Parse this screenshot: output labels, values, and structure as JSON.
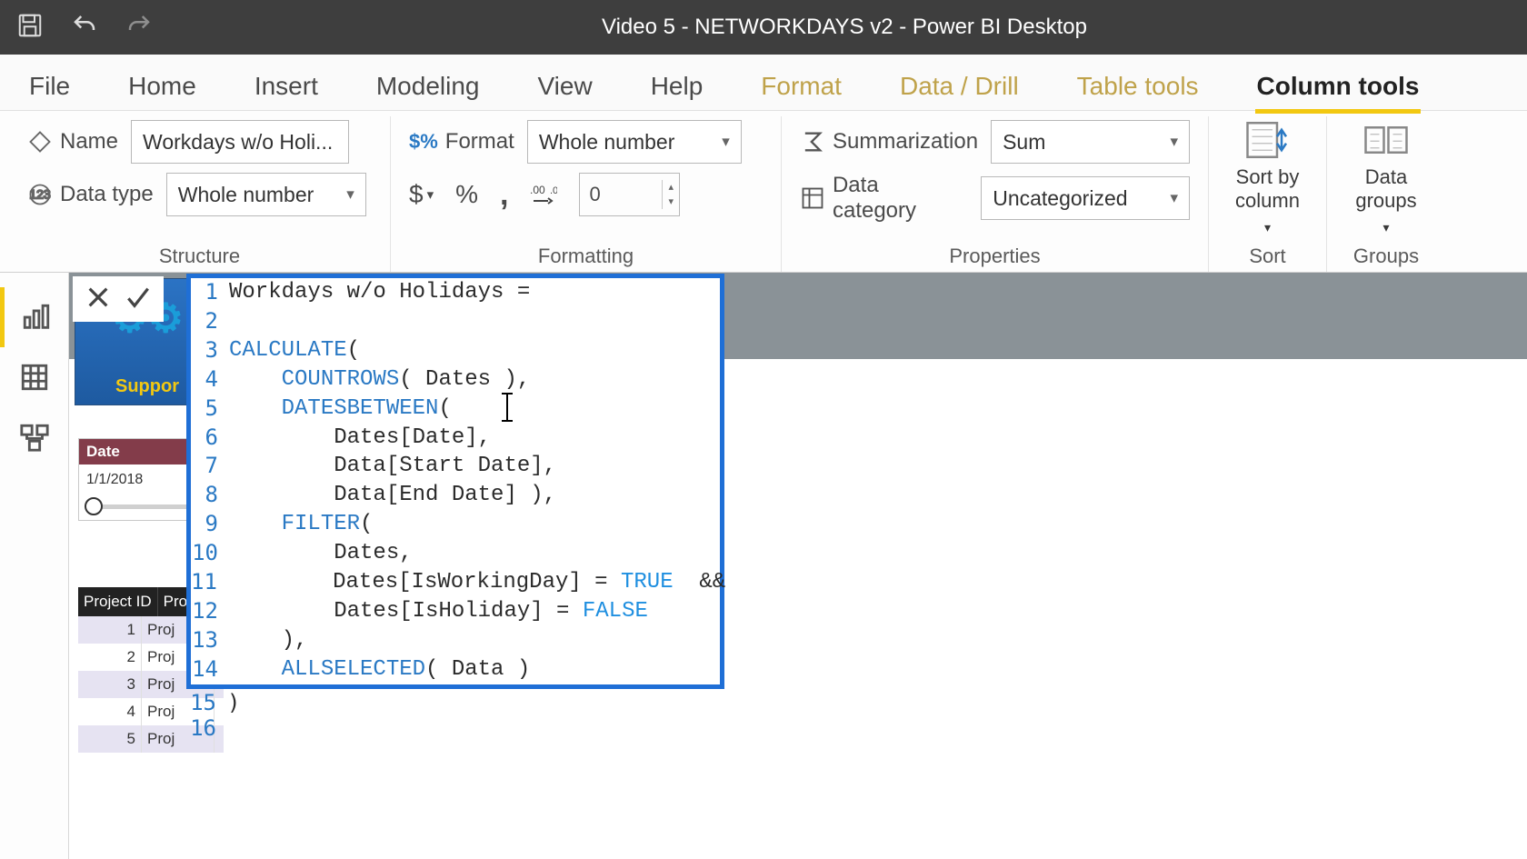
{
  "title": "Video 5 - NETWORKDAYS v2 - Power BI Desktop",
  "qat": {
    "save": "save-icon",
    "undo": "undo-icon",
    "redo": "redo-icon"
  },
  "tabs": [
    "File",
    "Home",
    "Insert",
    "Modeling",
    "View",
    "Help",
    "Format",
    "Data / Drill",
    "Table tools",
    "Column tools"
  ],
  "active_tab_index": 9,
  "contextual_start_index": 6,
  "ribbon": {
    "structure": {
      "label": "Structure",
      "name_label": "Name",
      "name_value": "Workdays w/o Holi...",
      "datatype_label": "Data type",
      "datatype_value": "Whole number"
    },
    "formatting": {
      "label": "Formatting",
      "format_label": "Format",
      "format_value": "Whole number",
      "currency": "$",
      "percent": "%",
      "thousand": ",",
      "decimals_icon": ".00→.0",
      "decimals_value": "0"
    },
    "properties": {
      "label": "Properties",
      "summarization_label": "Summarization",
      "summarization_value": "Sum",
      "category_label": "Data category",
      "category_value": "Uncategorized"
    },
    "sort": {
      "label": "Sort",
      "button": "Sort by\ncolumn"
    },
    "groups": {
      "label": "Groups",
      "button": "Data\ngroups"
    }
  },
  "leftnav": [
    "report-view",
    "data-view",
    "model-view"
  ],
  "slicer": {
    "header": "Date",
    "value": "1/1/2018"
  },
  "support_text": "Suppor",
  "table": {
    "headers": [
      "Project ID",
      "Proj"
    ],
    "rows": [
      [
        "1",
        "Proj"
      ],
      [
        "2",
        "Proj"
      ],
      [
        "3",
        "Proj"
      ],
      [
        "4",
        "Proj"
      ],
      [
        "5",
        "Proj"
      ]
    ]
  },
  "formula": {
    "cancel": "×",
    "commit": "✓",
    "lines": [
      {
        "n": "1",
        "tokens": [
          {
            "t": "txt",
            "v": "Workdays w/o Holidays = "
          }
        ]
      },
      {
        "n": "2",
        "tokens": [
          {
            "t": "txt",
            "v": ""
          }
        ]
      },
      {
        "n": "3",
        "tokens": [
          {
            "t": "fn",
            "v": "CALCULATE"
          },
          {
            "t": "txt",
            "v": "("
          }
        ]
      },
      {
        "n": "4",
        "tokens": [
          {
            "t": "txt",
            "v": "    "
          },
          {
            "t": "fn",
            "v": "COUNTROWS"
          },
          {
            "t": "txt",
            "v": "( Dates ),"
          }
        ]
      },
      {
        "n": "5",
        "tokens": [
          {
            "t": "txt",
            "v": "    "
          },
          {
            "t": "fn",
            "v": "DATESBETWEEN"
          },
          {
            "t": "txt",
            "v": "("
          },
          {
            "t": "cursor",
            "v": ""
          }
        ]
      },
      {
        "n": "6",
        "tokens": [
          {
            "t": "txt",
            "v": "        Dates[Date],"
          }
        ]
      },
      {
        "n": "7",
        "tokens": [
          {
            "t": "txt",
            "v": "        Data[Start Date],"
          }
        ]
      },
      {
        "n": "8",
        "tokens": [
          {
            "t": "txt",
            "v": "        Data[End Date] ),"
          }
        ]
      },
      {
        "n": "9",
        "tokens": [
          {
            "t": "txt",
            "v": "    "
          },
          {
            "t": "fn",
            "v": "FILTER"
          },
          {
            "t": "txt",
            "v": "("
          }
        ]
      },
      {
        "n": "10",
        "tokens": [
          {
            "t": "txt",
            "v": "        Dates,"
          }
        ]
      },
      {
        "n": "11",
        "tokens": [
          {
            "t": "txt",
            "v": "        Dates[IsWorkingDay] = "
          },
          {
            "t": "tf",
            "v": "TRUE"
          },
          {
            "t": "txt",
            "v": "  &&"
          }
        ]
      },
      {
        "n": "12",
        "tokens": [
          {
            "t": "txt",
            "v": "        Dates[IsHoliday] = "
          },
          {
            "t": "tf",
            "v": "FALSE"
          }
        ]
      },
      {
        "n": "13",
        "tokens": [
          {
            "t": "txt",
            "v": "    ),"
          }
        ]
      },
      {
        "n": "14",
        "tokens": [
          {
            "t": "txt",
            "v": "    "
          },
          {
            "t": "fn",
            "v": "ALLSELECTED"
          },
          {
            "t": "txt",
            "v": "( Data )"
          }
        ]
      }
    ],
    "trailing": [
      {
        "n": "15",
        "tokens": [
          {
            "t": "txt",
            "v": ")"
          }
        ]
      },
      {
        "n": "16",
        "tokens": [
          {
            "t": "txt",
            "v": ""
          }
        ]
      }
    ]
  }
}
